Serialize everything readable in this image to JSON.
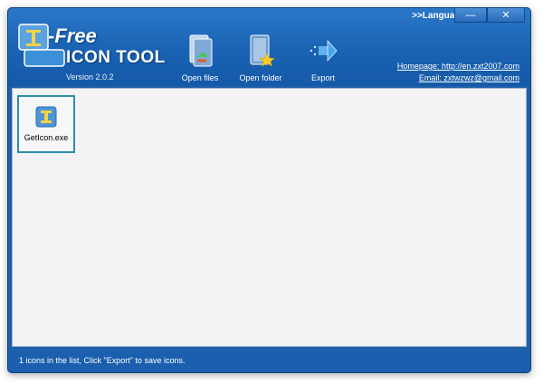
{
  "window": {
    "language_label": ">>Language",
    "minimize": "—",
    "close": "✕"
  },
  "branding": {
    "title_line1": "-Free",
    "title_line2": "ICON TOOL",
    "version": "Version 2.0.2"
  },
  "toolbar": {
    "open_files": "Open files",
    "open_folder": "Open folder",
    "export": "Export"
  },
  "links": {
    "homepage": "Homepage: http://en.zxt2007.com",
    "email": "Email: zxtwzwz@gmail.com"
  },
  "icons_list": [
    {
      "name": "GetIcon.exe"
    }
  ],
  "status": {
    "text": "1 icons in the list, Click \"Export\" to save icons."
  }
}
